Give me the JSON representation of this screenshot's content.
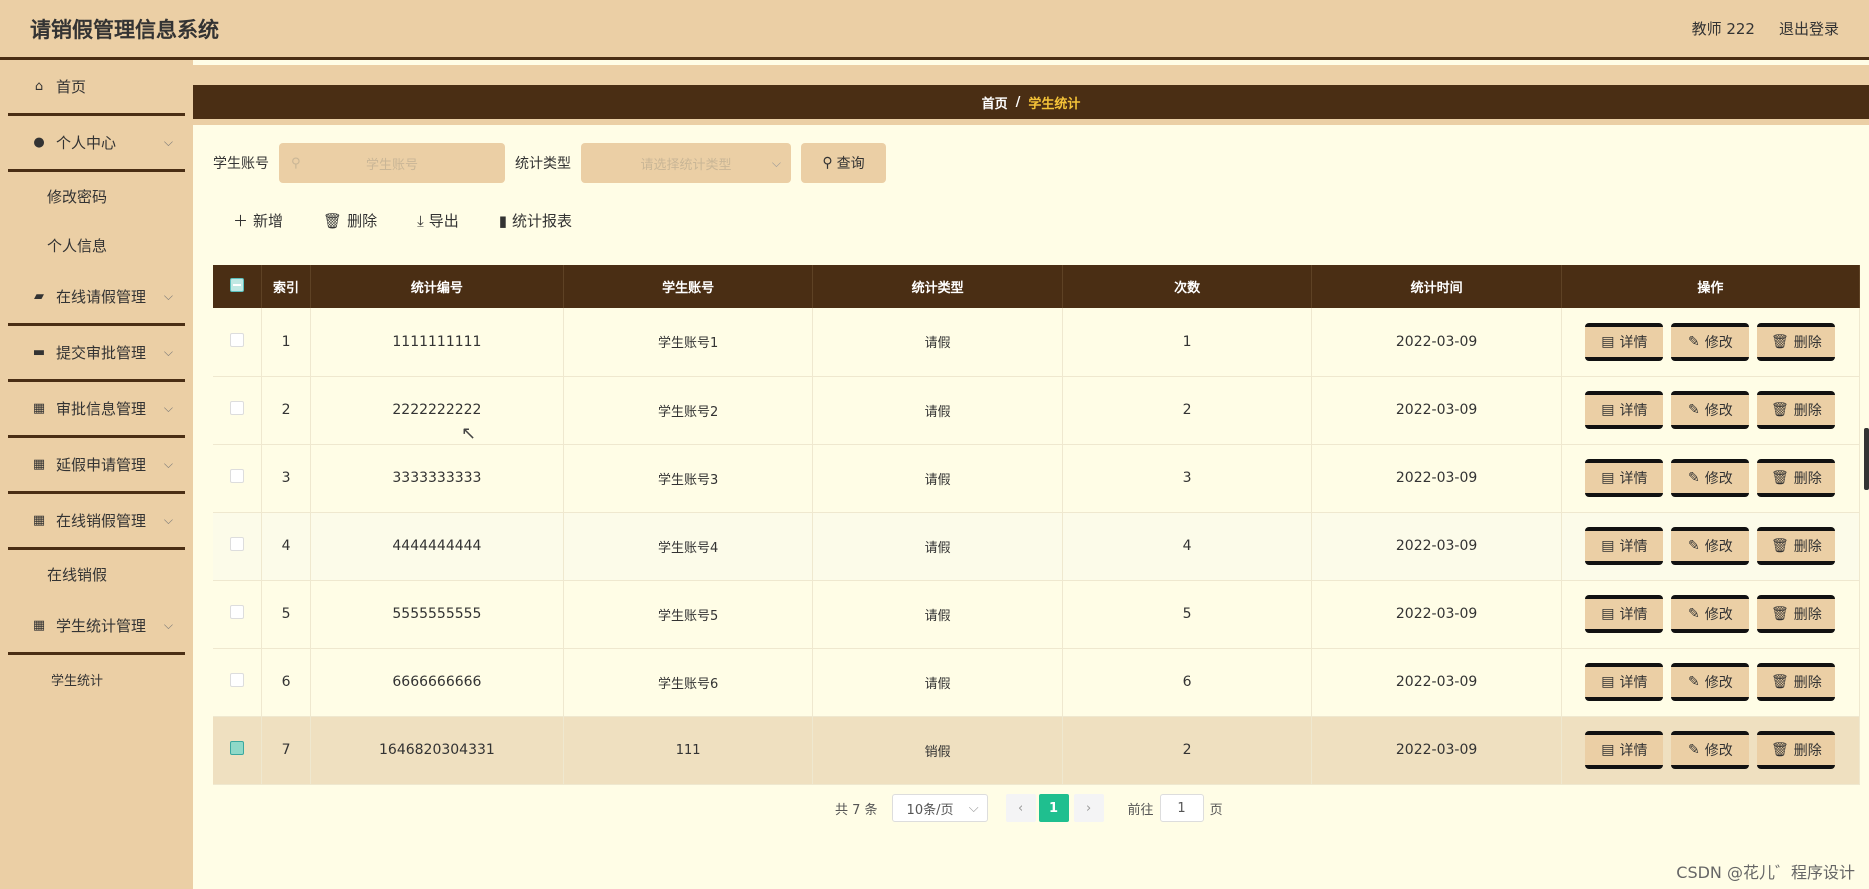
{
  "header": {
    "title": "请销假管理信息系统",
    "user": "教师 222",
    "logout": "退出登录"
  },
  "sidebar": {
    "home": "首页",
    "personal": "个人中心",
    "change_pwd": "修改密码",
    "profile": "个人信息",
    "leave_mgmt": "在线请假管理",
    "approval_submit": "提交审批管理",
    "approval_info": "审批信息管理",
    "extension": "延假申请管理",
    "cancel_mgmt": "在线销假管理",
    "cancel": "在线销假",
    "stats_mgmt": "学生统计管理",
    "stats": "学生统计"
  },
  "breadcrumb": {
    "home": "首页",
    "sep": "/",
    "current": "学生统计"
  },
  "search": {
    "account_label": "学生账号",
    "account_placeholder": "学生账号",
    "type_label": "统计类型",
    "type_placeholder": "请选择统计类型",
    "query": "查询"
  },
  "toolbar": {
    "add": "新增",
    "delete": "删除",
    "export": "导出",
    "report": "统计报表"
  },
  "table": {
    "headers": [
      "索引",
      "统计编号",
      "学生账号",
      "统计类型",
      "次数",
      "统计时间",
      "操作"
    ],
    "rows": [
      {
        "idx": "1",
        "code": "1111111111",
        "account": "学生账号1",
        "type": "请假",
        "count": "1",
        "time": "2022-03-09"
      },
      {
        "idx": "2",
        "code": "2222222222",
        "account": "学生账号2",
        "type": "请假",
        "count": "2",
        "time": "2022-03-09"
      },
      {
        "idx": "3",
        "code": "3333333333",
        "account": "学生账号3",
        "type": "请假",
        "count": "3",
        "time": "2022-03-09"
      },
      {
        "idx": "4",
        "code": "4444444444",
        "account": "学生账号4",
        "type": "请假",
        "count": "4",
        "time": "2022-03-09"
      },
      {
        "idx": "5",
        "code": "5555555555",
        "account": "学生账号5",
        "type": "请假",
        "count": "5",
        "time": "2022-03-09"
      },
      {
        "idx": "6",
        "code": "6666666666",
        "account": "学生账号6",
        "type": "请假",
        "count": "6",
        "time": "2022-03-09"
      },
      {
        "idx": "7",
        "code": "1646820304331",
        "account": "111",
        "type": "销假",
        "count": "2",
        "time": "2022-03-09"
      }
    ],
    "ops": {
      "detail": "详情",
      "edit": "修改",
      "remove": "删除"
    }
  },
  "pager": {
    "total": "共 7 条",
    "page_size": "10条/页",
    "current": "1",
    "goto": "前往",
    "goto_value": "1",
    "page_unit": "页"
  },
  "watermark": "CSDN @花儿゛程序设计"
}
